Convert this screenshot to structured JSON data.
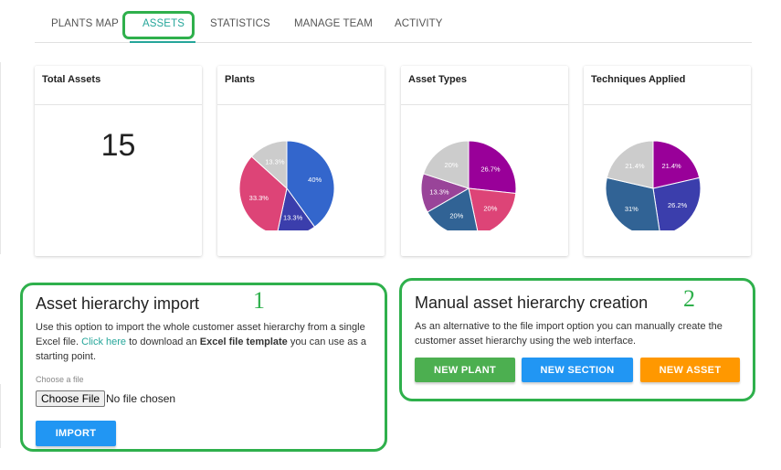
{
  "tabs": [
    {
      "label": "PLANTS MAP",
      "active": false
    },
    {
      "label": "ASSETS",
      "active": true
    },
    {
      "label": "STATISTICS",
      "active": false
    },
    {
      "label": "MANAGE TEAM",
      "active": false
    },
    {
      "label": "ACTIVITY",
      "active": false
    }
  ],
  "colors": {
    "accent": "#26a69a",
    "annotation": "#2fb04c",
    "green_button": "#4caf50",
    "blue_button": "#2196f3",
    "orange_button": "#ff9800"
  },
  "total_assets": {
    "title": "Total Assets",
    "value": "15"
  },
  "chart_data": [
    {
      "type": "pie",
      "title": "Plants",
      "slices": [
        {
          "label": "40%",
          "value": 40,
          "color": "#3366cc"
        },
        {
          "label": "13.3%",
          "value": 13.3,
          "color": "#3b3eac"
        },
        {
          "label": "33.3%",
          "value": 33.3,
          "color": "#dd4477"
        },
        {
          "label": "13.3%",
          "value": 13.3,
          "color": "#cccccc"
        }
      ]
    },
    {
      "type": "pie",
      "title": "Asset Types",
      "slices": [
        {
          "label": "26.7%",
          "value": 26.7,
          "color": "#990099"
        },
        {
          "label": "20%",
          "value": 20,
          "color": "#dd4477"
        },
        {
          "label": "20%",
          "value": 20,
          "color": "#316395"
        },
        {
          "label": "13.3%",
          "value": 13.3,
          "color": "#994499"
        },
        {
          "label": "20%",
          "value": 20,
          "color": "#cccccc"
        }
      ]
    },
    {
      "type": "pie",
      "title": "Techniques Applied",
      "slices": [
        {
          "label": "21.4%",
          "value": 21.4,
          "color": "#990099"
        },
        {
          "label": "26.2%",
          "value": 26.2,
          "color": "#3b3eac"
        },
        {
          "label": "31%",
          "value": 31,
          "color": "#316395"
        },
        {
          "label": "21.4%",
          "value": 21.4,
          "color": "#cccccc"
        }
      ]
    }
  ],
  "import_panel": {
    "annotation": "1",
    "title": "Asset hierarchy import",
    "desc_before": "Use this option to import the whole customer asset hierarchy from a single Excel file. ",
    "link_text": "Click here",
    "desc_mid": " to download an ",
    "desc_bold": "Excel file template",
    "desc_after": " you can use as a starting point.",
    "file_label": "Choose a file",
    "file_button": "Choose File",
    "file_status": "No file chosen",
    "import_button": "IMPORT"
  },
  "manual_panel": {
    "annotation": "2",
    "title": "Manual asset hierarchy creation",
    "desc": "As an alternative to the file import option you can manually create the customer asset hierarchy using the web interface.",
    "buttons": {
      "new_plant": "NEW PLANT",
      "new_section": "NEW SECTION",
      "new_asset": "NEW ASSET"
    }
  }
}
